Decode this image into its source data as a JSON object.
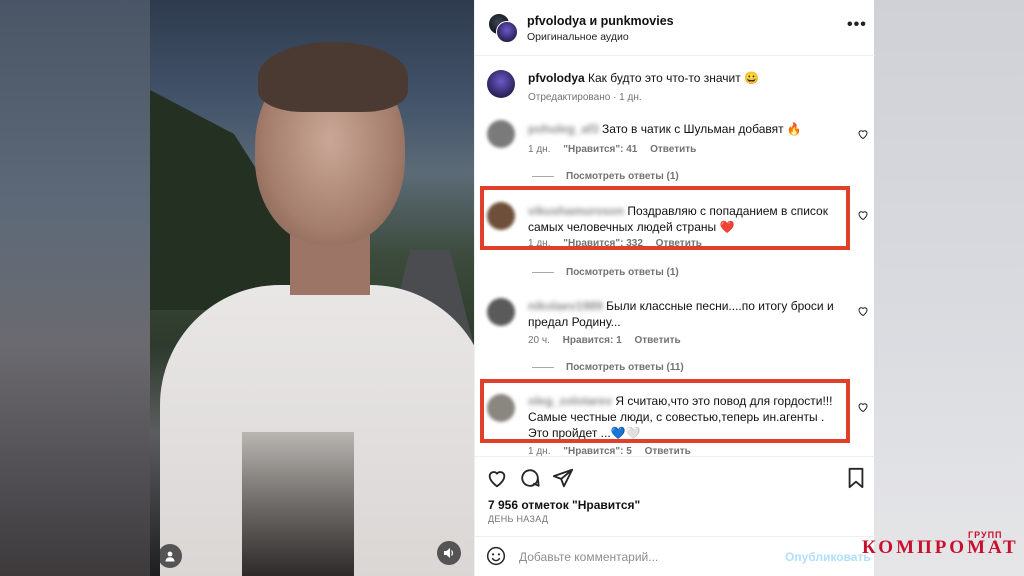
{
  "header": {
    "title": "pfvolodya и punkmovies",
    "audio": "Оригинальное аудио",
    "more": "•••"
  },
  "caption": {
    "user": "pfvolodya",
    "text": "Как будто это что-то значит 😀",
    "meta": "Отредактировано · 1 дн."
  },
  "comments": [
    {
      "user": "pohuleg_af3",
      "text": "Зато в чатик с Шульман добавят 🔥",
      "time": "1 дн.",
      "likes": "\"Нравится\": 41",
      "reply": "Ответить",
      "view_replies": "Посмотреть ответы (1)"
    },
    {
      "user": "vikushamuroson",
      "text": "Поздравляю с попаданием в список самых человечных людей страны ❤️",
      "time": "1 дн.",
      "likes": "\"Нравится\": 332",
      "reply": "Ответить",
      "view_replies": "Посмотреть ответы (1)"
    },
    {
      "user": "nikolaev1989",
      "text": "Были классные песни....по итогу броси и предал Родину...",
      "time": "20 ч.",
      "likes": "Нравится: 1",
      "reply": "Ответить",
      "view_replies": "Посмотреть ответы (11)"
    },
    {
      "user": "oleg_zolotarev",
      "text": "Я считаю,что это повод для гордости!!! Самые честные люди, с совестью,теперь ин.агенты . Это пройдет ...💙🤍",
      "time": "1 дн.",
      "likes": "\"Нравится\": 5",
      "reply": "Ответить"
    }
  ],
  "footer": {
    "likes": "7 956 отметок \"Нравится\"",
    "ago": "ДЕНЬ НАЗАД",
    "placeholder": "Добавьте комментарий...",
    "publish": "Опубликовать"
  },
  "watermark": {
    "main": "КОМПРОМАТ",
    "small": "ГРУПП"
  },
  "colors": {
    "highlight": "#e0402a",
    "watermark": "#c8102e",
    "publish": "#b2dffc"
  },
  "icons": [
    "user-icon",
    "sound-icon",
    "heart-icon",
    "comment-icon",
    "share-icon",
    "bookmark-icon",
    "emoji-icon",
    "more-icon"
  ]
}
